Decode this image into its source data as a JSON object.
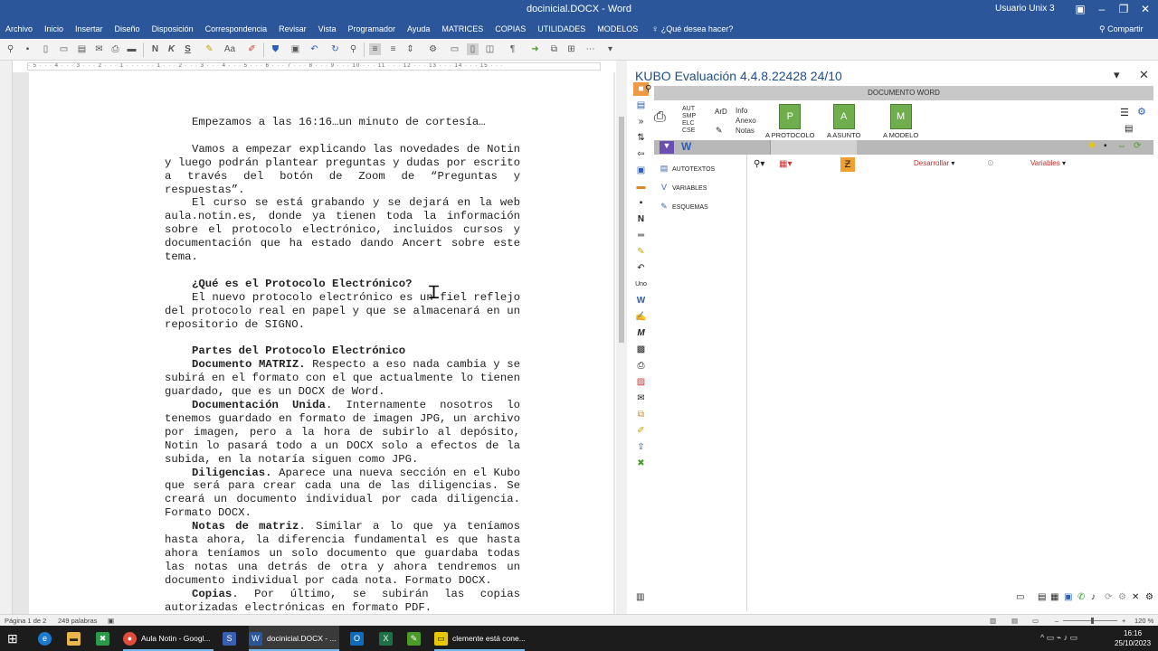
{
  "window": {
    "title": "docinicial.DOCX  -  Word",
    "user": "Usuario Unix 3",
    "share": "Compartir"
  },
  "ribbon_tabs": [
    "Archivo",
    "Inicio",
    "Insertar",
    "Diseño",
    "Disposición",
    "Correspondencia",
    "Revisar",
    "Vista",
    "Programador",
    "Ayuda",
    "MATRICES",
    "COPIAS",
    "UTILIDADES",
    "MODELOS"
  ],
  "tell_me": "¿Qué desea hacer?",
  "toolbar_glyphs": {
    "bold": "N",
    "italic": "K",
    "underline": "S",
    "font_case": "Aa"
  },
  "ruler": "· 5 · · · 4 · · · 3 · · · 2 · · · 1 · · · · · · 1 · · · 2 · · · 3 · · · 4 · · · 5 · · · 6 · · · 7 · · · 8 · · · 9 · · · 10 · · · 11 · · · 12 · · · 13 · · · 14 · · · 15 · · ·",
  "document": {
    "p1": "Empezamos a las 16:16…un minuto de cortesía…",
    "p2": "Vamos a empezar explicando las novedades de Notin y luego podrán plantear preguntas y dudas por escrito a través del botón de Zoom de “Preguntas y respuestas”.",
    "p3": "El curso se está grabando y se dejará en la web aula.notin.es, donde ya tienen toda la información sobre el protocolo electrónico, incluidos cursos y documentación que ha estado dando Ancert sobre este tema.",
    "h1": "¿Qué es el Protocolo Electrónico?",
    "p4": "El nuevo protocolo electrónico es un fiel reflejo del protocolo real en papel y que se almacenará en un repositorio de SIGNO.",
    "h2": "Partes del Protocolo Electrónico",
    "matriz_label": "Documento MATRIZ.",
    "matriz_text": " Respecto a eso nada cambia y se subirá en el formato con el que actualmente lo tienen guardado, que es un DOCX de Word.",
    "unida_label": "Documentación Unida",
    "unida_text": ". Internamente nosotros lo tenemos guardado en formato de imagen JPG, un archivo por imagen, pero a la hora de subirlo al depósito, Notin lo pasará todo a un DOCX solo a efectos de la subida, en la notaría siguen como JPG.",
    "dilig_label": "Diligencias.",
    "dilig_text": " Aparece una nueva sección en el Kubo que será para crear cada una de las diligencias. Se creará un documento individual por cada diligencia. Formato DOCX.",
    "notas_label": "Notas de matriz",
    "notas_text": ". Similar a lo que ya teníamos hasta ahora, la diferencia fundamental es que hasta ahora teníamos un solo documento que guardaba todas las notas una detrás de otra y ahora tendremos un documento individual por cada nota. Formato DOCX.",
    "copias_label": "Copias",
    "copias_text": ". Por último, se subirán las copias autorizadas electrónicas en formato PDF."
  },
  "kubo": {
    "title": "KUBO Evaluación 4.4.8.22428   24/10",
    "band": "DOCUMENTO WORD",
    "small_labels": [
      "AUT",
      "SMP",
      "ELC",
      "CSE"
    ],
    "ard_label": "ArD",
    "info_labels": [
      "Info",
      "Anexo",
      "Notas"
    ],
    "big_buttons": [
      "A PROTOCOLO",
      "A ASUNTO",
      "A MODELO"
    ],
    "sidebar": [
      "AUTOTEXTOS",
      "VARIABLES",
      "ESQUEMAS"
    ],
    "desarrollar": "Desarrollar",
    "variables": "Variables",
    "side_letters": {
      "n_icon": "N",
      "w_icon": "W",
      "uno": "Uno",
      "m_icon": "M"
    }
  },
  "statusbar": {
    "page": "Página 1 de 2",
    "words": "249 palabras",
    "zoom": "120 %"
  },
  "taskbar": {
    "items": [
      "Aula Notin - Googl...",
      "docinicial.DOCX - ...",
      "clemente está cone..."
    ],
    "time": "16:16",
    "date": "25/10/2023"
  },
  "colors": {
    "word_blue": "#2b579a",
    "kubo_title": "#1e4e8c",
    "kubo_green": "#6fae4c",
    "kubo_red": "#c12b2b"
  }
}
